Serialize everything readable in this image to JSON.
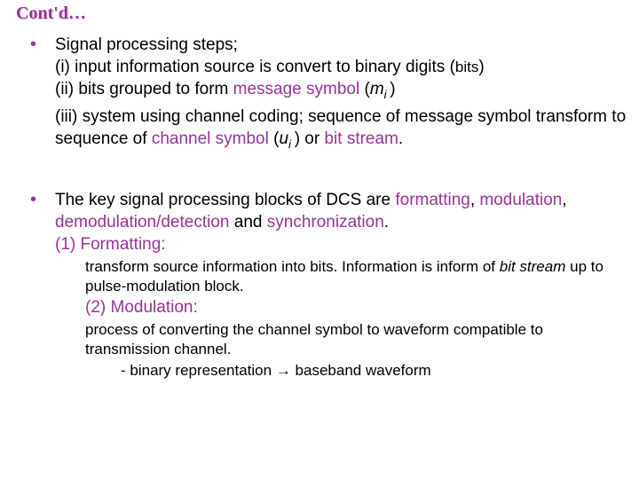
{
  "title": "Cont'd…",
  "bullet_glyph": "•",
  "item1": {
    "lead": "Signal processing steps;",
    "i_pre": "(i) input information source is convert to binary digits (",
    "i_bits": "bits",
    "i_post": ")",
    "ii_pre": "(ii) bits grouped to form ",
    "ii_msg": "message symbol",
    "ii_open": " (",
    "ii_m": "m",
    "ii_sub": "i ",
    "ii_close": ")",
    "iii_pre": "(iii) system using channel coding; sequence of message symbol transform to sequence of ",
    "iii_cs": "channel symbol",
    "iii_open": " (",
    "iii_u": "u",
    "iii_sub": "i ",
    "iii_mid": ") or ",
    "iii_bs": "bit stream",
    "iii_end": "."
  },
  "item2": {
    "lead_pre": "The key signal processing blocks of DCS are ",
    "fmt": "formatting",
    "c1": ", ",
    "mod": "modulation",
    "c2": ", ",
    "demod": "demodulation/detection",
    "c3": " and ",
    "sync": "synchronization",
    "end": ".",
    "h1": "(1) Formatting:",
    "s1a": "transform source information into bits. Information is inform of ",
    "s1b": "bit stream",
    "s1c": " up to pulse-modulation block.",
    "h2": "(2) Modulation:",
    "s2a": "process of converting the channel symbol to waveform compatible to transmission channel.",
    "s2b_pre": "- binary representation ",
    "s2b_arrow": "→",
    "s2b_post": " baseband waveform"
  }
}
